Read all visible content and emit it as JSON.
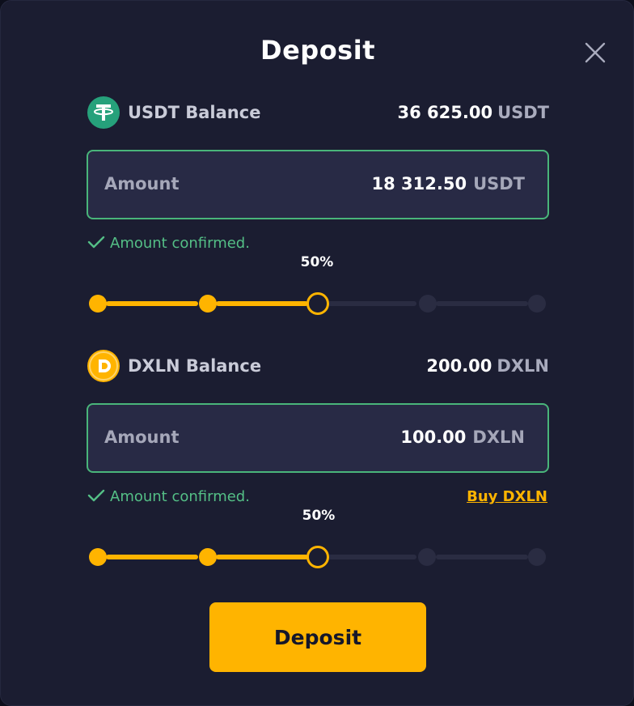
{
  "modal": {
    "title": "Deposit",
    "close_icon": "close-icon"
  },
  "usdt": {
    "icon": "tether-coin-icon",
    "balance_label": "USDT Balance",
    "balance_value": "36 625.00",
    "balance_unit": "USDT",
    "amount_label": "Amount",
    "amount_value": "18 312.50",
    "amount_unit": "USDT",
    "status_text": "Amount confirmed.",
    "slider_label": "50%",
    "slider_value_percent": 50,
    "slider_steps": [
      0,
      25,
      50,
      75,
      100
    ]
  },
  "dxln": {
    "icon": "dxln-coin-icon",
    "balance_label": "DXLN Balance",
    "balance_value": "200.00",
    "balance_unit": "DXLN",
    "amount_label": "Amount",
    "amount_value": "100.00",
    "amount_unit": "DXLN",
    "status_text": "Amount confirmed.",
    "buy_link": "Buy DXLN",
    "slider_label": "50%",
    "slider_value_percent": 50,
    "slider_steps": [
      0,
      25,
      50,
      75,
      100
    ]
  },
  "actions": {
    "deposit_label": "Deposit"
  },
  "colors": {
    "accent": "#ffb400",
    "success": "#54bf86",
    "background": "#1b1d31",
    "input_bg": "#282a45",
    "tether_green": "#26a17b"
  }
}
